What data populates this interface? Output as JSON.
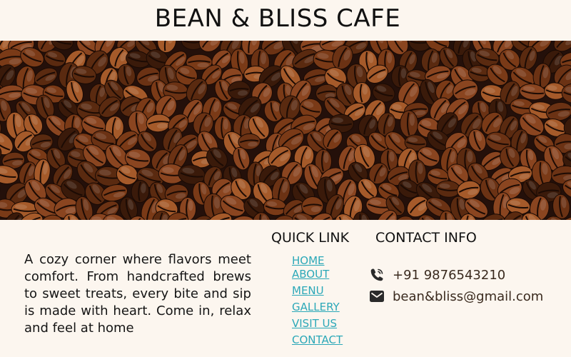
{
  "header": {
    "title": "BEAN & BLISS CAFE"
  },
  "hero": {
    "image": "coffee-beans-banner"
  },
  "about": {
    "text": "A cozy corner where flavors meet comfort. From handcrafted brews to sweet treats, every bite and sip is made with heart. Come in, relax and feel at home"
  },
  "quick_links": {
    "heading": "QUICK LINK",
    "items": [
      {
        "label": "HOME"
      },
      {
        "label": "ABOUT"
      },
      {
        "label": "MENU"
      },
      {
        "label": "GALLERY"
      },
      {
        "label": "VISIT US"
      },
      {
        "label": "CONTACT"
      }
    ]
  },
  "contact": {
    "heading": "CONTACT INFO",
    "phone": "+91 9876543210",
    "email": "bean&bliss@gmail.com",
    "phone_icon": "phone-icon",
    "email_icon": "mail-icon"
  },
  "colors": {
    "background": "#fcf6ef",
    "link": "#2ba8b8",
    "bean_dark": "#3a1a0a",
    "bean_mid": "#7a3a17",
    "bean_light": "#a55a2a"
  }
}
